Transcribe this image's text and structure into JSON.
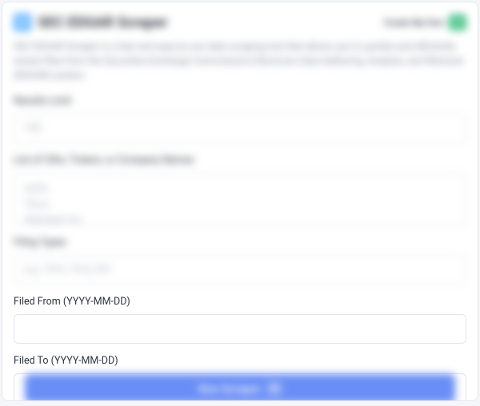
{
  "header": {
    "title": "SEC EDGAR Scraper",
    "cta_label": "Create My Own",
    "icon": "document-icon"
  },
  "description": "SEC EDGAR Scraper is a fast and easy-to-use data scraping tool that allows you to quickly and efficiently extract files from the Securities Exchange Commission's Electronic Data Gathering, Analysis, and Retrieval (EDGAR) system.",
  "fields": {
    "results_limit": {
      "label": "Results Limit",
      "placeholder": "100"
    },
    "identifiers": {
      "label": "List of CIKs, Tickers, or Company Names",
      "placeholder": "AAPL\nTSLA\nAlphabet Inc."
    },
    "filing_types": {
      "label": "Filing Types",
      "placeholder": "e.g. 10-K, 10-Q, 8-K"
    },
    "filed_from": {
      "label": "Filed From (YYYY-MM-DD)",
      "value": ""
    },
    "filed_to": {
      "label": "Filed To (YYYY-MM-DD)",
      "value": ""
    }
  },
  "run_button": {
    "label": "Run Scraper"
  }
}
